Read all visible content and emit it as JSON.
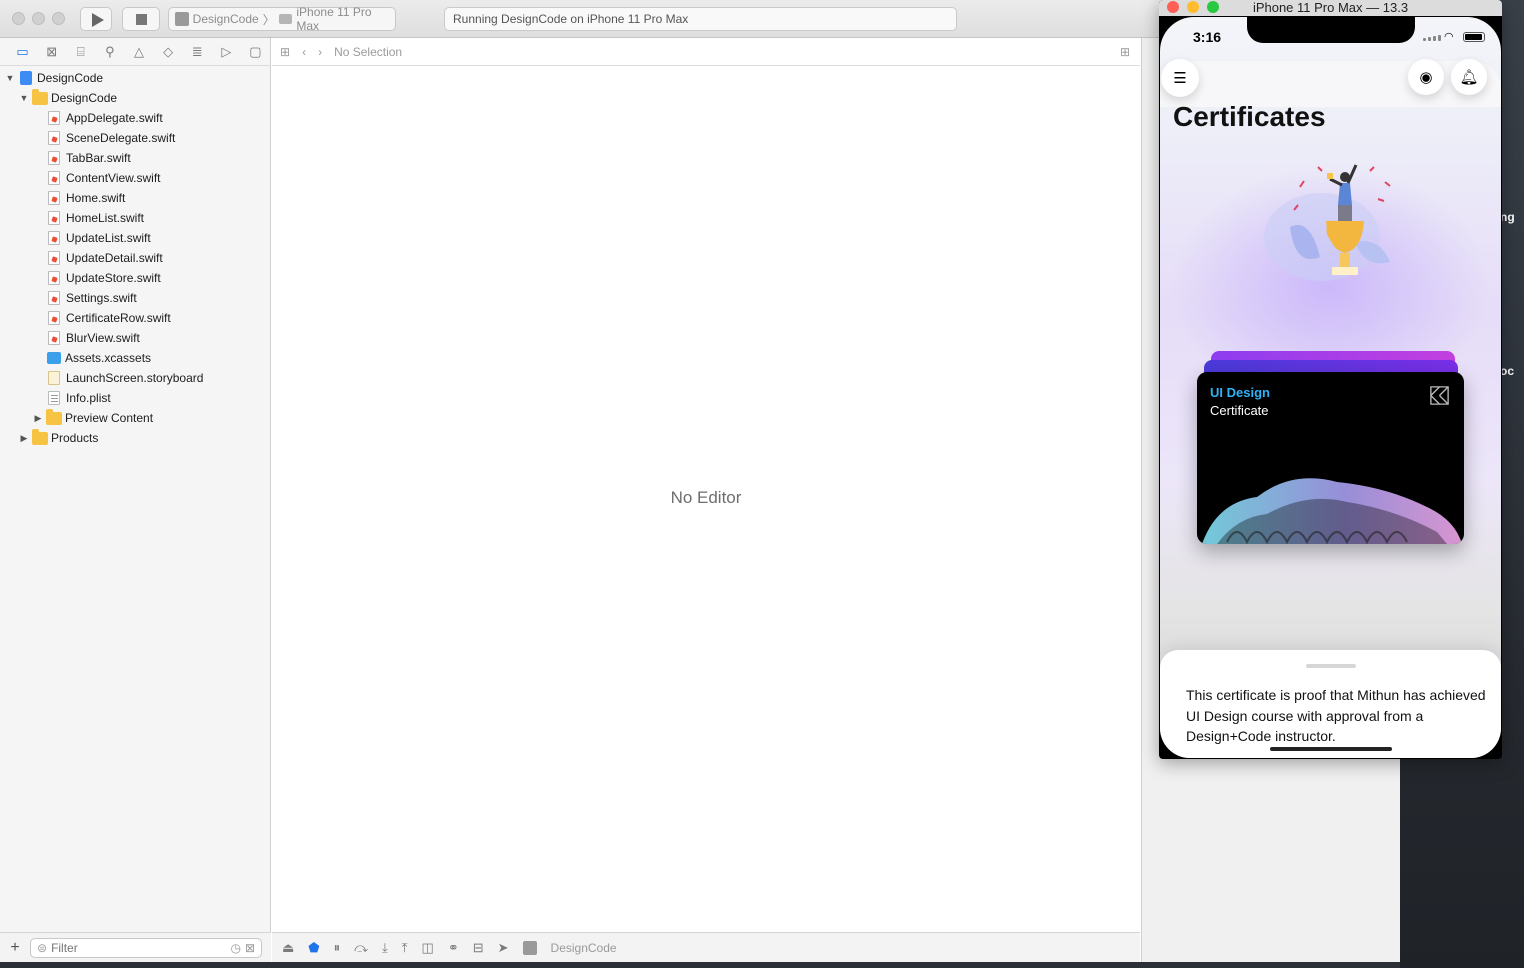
{
  "toolbar": {
    "scheme_target": "DesignCode",
    "scheme_device": "iPhone 11 Pro Max",
    "activity": "Running DesignCode on iPhone 11 Pro Max"
  },
  "navigator": {
    "tabs": [
      "folder-icon",
      "source-control-icon",
      "symbol-icon",
      "search-icon",
      "warning-icon",
      "test-icon",
      "debug-icon",
      "breakpoint-icon",
      "report-icon"
    ],
    "project": "DesignCode",
    "group": "DesignCode",
    "files": [
      {
        "name": "AppDelegate.swift",
        "kind": "swift"
      },
      {
        "name": "SceneDelegate.swift",
        "kind": "swift"
      },
      {
        "name": "TabBar.swift",
        "kind": "swift"
      },
      {
        "name": "ContentView.swift",
        "kind": "swift"
      },
      {
        "name": "Home.swift",
        "kind": "swift"
      },
      {
        "name": "HomeList.swift",
        "kind": "swift"
      },
      {
        "name": "UpdateList.swift",
        "kind": "swift"
      },
      {
        "name": "UpdateDetail.swift",
        "kind": "swift"
      },
      {
        "name": "UpdateStore.swift",
        "kind": "swift"
      },
      {
        "name": "Settings.swift",
        "kind": "swift"
      },
      {
        "name": "CertificateRow.swift",
        "kind": "swift"
      },
      {
        "name": "BlurView.swift",
        "kind": "swift"
      },
      {
        "name": "Assets.xcassets",
        "kind": "assets"
      },
      {
        "name": "LaunchScreen.storyboard",
        "kind": "storyboard"
      },
      {
        "name": "Info.plist",
        "kind": "plist"
      }
    ],
    "subgroup": "Preview Content",
    "products": "Products",
    "filter_placeholder": "Filter"
  },
  "editor": {
    "jump_label": "No Selection",
    "empty_message": "No Editor",
    "debug_target": "DesignCode"
  },
  "desktop": {
    "peek_1": "ng",
    "peek_2": "oc"
  },
  "simulator": {
    "window_title": "iPhone 11 Pro Max — 13.3",
    "status_time": "3:16",
    "page_title": "Certificates",
    "card_title": "UI Design",
    "card_subtitle": "Certificate",
    "sheet_text": "This certificate is proof that Mithun has achieved UI Design course with approval from a Design+Code instructor.",
    "card_title_color": "#2fb2f5"
  }
}
